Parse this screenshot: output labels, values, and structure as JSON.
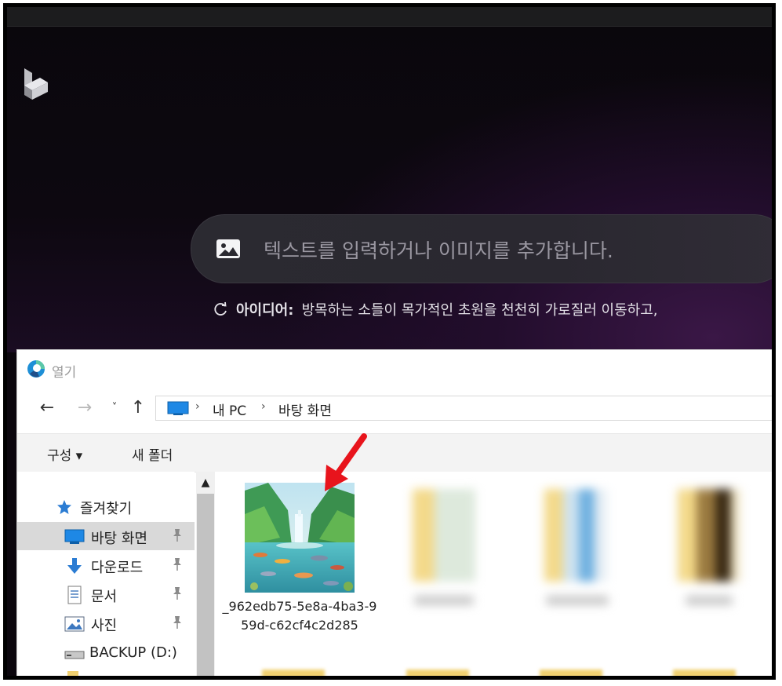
{
  "app": {
    "prompt_placeholder": "텍스트를 입력하거나 이미지를 추가합니다.",
    "idea_label": "아이디어:",
    "idea_text": "방목하는 소들이 목가적인 초원을 천천히 가로질러 이동하고,"
  },
  "dialog": {
    "title": "열기",
    "breadcrumb": [
      "내 PC",
      "바탕 화면"
    ],
    "toolbar": {
      "organize_label": "구성 ▾",
      "new_folder_label": "새 폴더"
    },
    "nav": {
      "quick_access_label": "즐겨찾기",
      "items": [
        {
          "label": "바탕 화면",
          "icon": "desktop-icon",
          "pinned": true,
          "selected": true
        },
        {
          "label": "다운로드",
          "icon": "download-icon",
          "pinned": true
        },
        {
          "label": "문서",
          "icon": "document-icon",
          "pinned": true
        },
        {
          "label": "사진",
          "icon": "pictures-icon",
          "pinned": true
        },
        {
          "label": "BACKUP (D:)",
          "icon": "drive-icon",
          "pinned": false
        }
      ]
    },
    "files": [
      {
        "name": "_962edb75-5e8a-4ba3-959d-c62cf4c2d285",
        "type": "image"
      }
    ]
  },
  "colors": {
    "annotation_arrow": "#e8141c",
    "accent": "#0078d4"
  }
}
